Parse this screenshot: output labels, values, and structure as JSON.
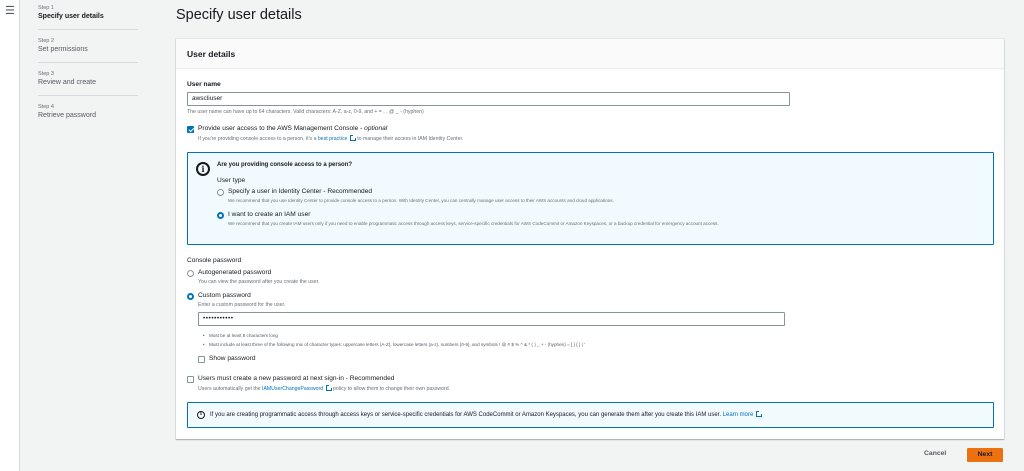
{
  "nav": {
    "menu_icon": "hamburger-icon"
  },
  "steps": [
    {
      "num": "Step 1",
      "name": "Specify user details"
    },
    {
      "num": "Step 2",
      "name": "Set permissions"
    },
    {
      "num": "Step 3",
      "name": "Review and create"
    },
    {
      "num": "Step 4",
      "name": "Retrieve password"
    }
  ],
  "page_title": "Specify user details",
  "panel": {
    "title": "User details",
    "username_label": "User name",
    "username_value": "awscliuser",
    "username_hint": "The user name can have up to 64 characters. Valid characters: A-Z, a-z, 0-9, and + = , . @ _ - (hyphen)",
    "console_access_label": "Provide user access to the AWS Management Console - ",
    "console_access_optional": "optional",
    "console_access_hint_pre": "If you're providing console access to a person, it's a ",
    "console_access_hint_link": "best practice",
    "console_access_hint_post": " to manage their access in IAM Identity Center.",
    "console_access_checked": true
  },
  "person_box": {
    "icon": "info-icon",
    "question": "Are you providing console access to a person?",
    "user_type_label": "User type",
    "opt1_label": "Specify a user in Identity Center - Recommended",
    "opt1_desc": "We recommend that you use Identity Center to provide console access to a person. With Identity Center, you can centrally manage user access to their AWS accounts and cloud applications.",
    "opt2_label": "I want to create an IAM user",
    "opt2_desc": "We recommend that you create IAM users only if you need to enable programmatic access through access keys, service-specific credentials for AWS CodeCommit or Amazon Keyspaces, or a backup credential for emergency account access.",
    "selected": "opt2"
  },
  "password": {
    "label": "Console password",
    "auto_label": "Autogenerated password",
    "auto_hint": "You can view the password after you create the user.",
    "custom_label": "Custom password",
    "custom_hint": "Enter a custom password for the user.",
    "value": "•••••••••••",
    "rule1": "Must be at least 8 characters long",
    "rule2": "Must include at least three of the following mix of character types: uppercase letters (A-Z), lowercase letters (a-z), numbers (0-9), and symbols ! @ # $ % ^ & * ( ) _ + - (hyphen) = [ ] { } | '",
    "show_label": "Show password",
    "selected": "custom"
  },
  "reset": {
    "label": "Users must create a new password at next sign-in - Recommended",
    "hint_pre": "Users automatically get the ",
    "hint_link": "IAMUserChangePassword",
    "hint_post": " policy to allow them to change their own password."
  },
  "bottom_info": {
    "text": "If you are creating programmatic access through access keys or service-specific credentials for AWS CodeCommit or Amazon Keyspaces, you can generate them after you create this IAM user. ",
    "link": "Learn more"
  },
  "actions": {
    "cancel": "Cancel",
    "next": "Next"
  }
}
